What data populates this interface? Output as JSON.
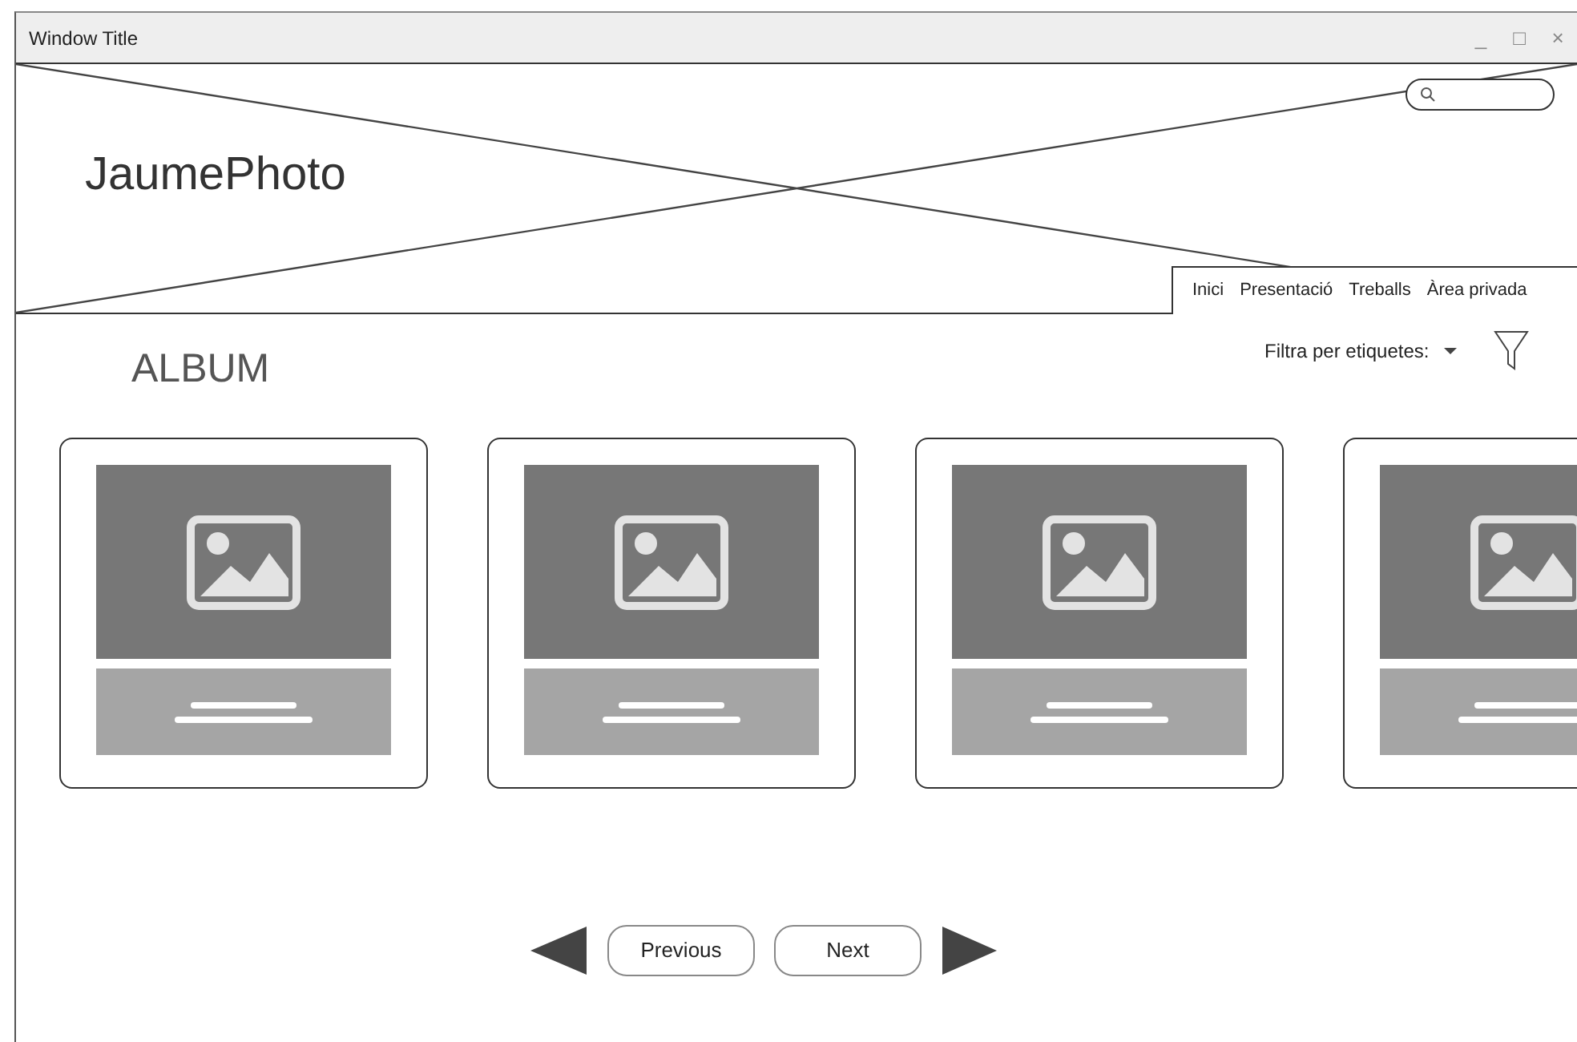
{
  "window": {
    "title": "Window Title",
    "controls": [
      "_",
      "□",
      "×"
    ]
  },
  "header": {
    "logo": "JaumePhoto",
    "nav": [
      "Inici",
      "Presentació",
      "Treballs",
      "Àrea privada"
    ]
  },
  "album": {
    "title": "ALBUM",
    "filter_label": "Filtra per etiquetes:"
  },
  "cards": [
    {
      "kind": "image-card"
    },
    {
      "kind": "image-card"
    },
    {
      "kind": "image-card"
    },
    {
      "kind": "image-card"
    }
  ],
  "pagination": {
    "previous": "Previous",
    "next": "Next"
  }
}
